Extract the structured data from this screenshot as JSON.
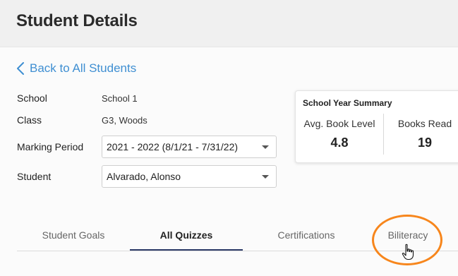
{
  "header": {
    "title": "Student Details"
  },
  "back_link": {
    "label": "Back to All Students"
  },
  "fields": {
    "school_label": "School",
    "school_value": "School 1",
    "class_label": "Class",
    "class_value": "G3, Woods",
    "marking_period_label": "Marking Period",
    "marking_period_value": "2021 - 2022 (8/1/21 - 7/31/22)",
    "student_label": "Student",
    "student_value": "Alvarado, Alonso"
  },
  "summary": {
    "title": "School Year Summary",
    "avg_book_level_label": "Avg. Book Level",
    "avg_book_level_value": "4.8",
    "books_read_label": "Books Read",
    "books_read_value": "19"
  },
  "tabs": [
    {
      "label": "Student Goals"
    },
    {
      "label": "All Quizzes",
      "active": true
    },
    {
      "label": "Certifications"
    },
    {
      "label": "Biliteracy"
    }
  ],
  "colors": {
    "link": "#3f8fd2",
    "active_tab_underline": "#2b3a67",
    "highlight": "#f7861c"
  },
  "icons": {
    "back": "chevron-left-icon",
    "dropdown": "caret-down-icon",
    "pointer": "hand-pointer-icon"
  }
}
